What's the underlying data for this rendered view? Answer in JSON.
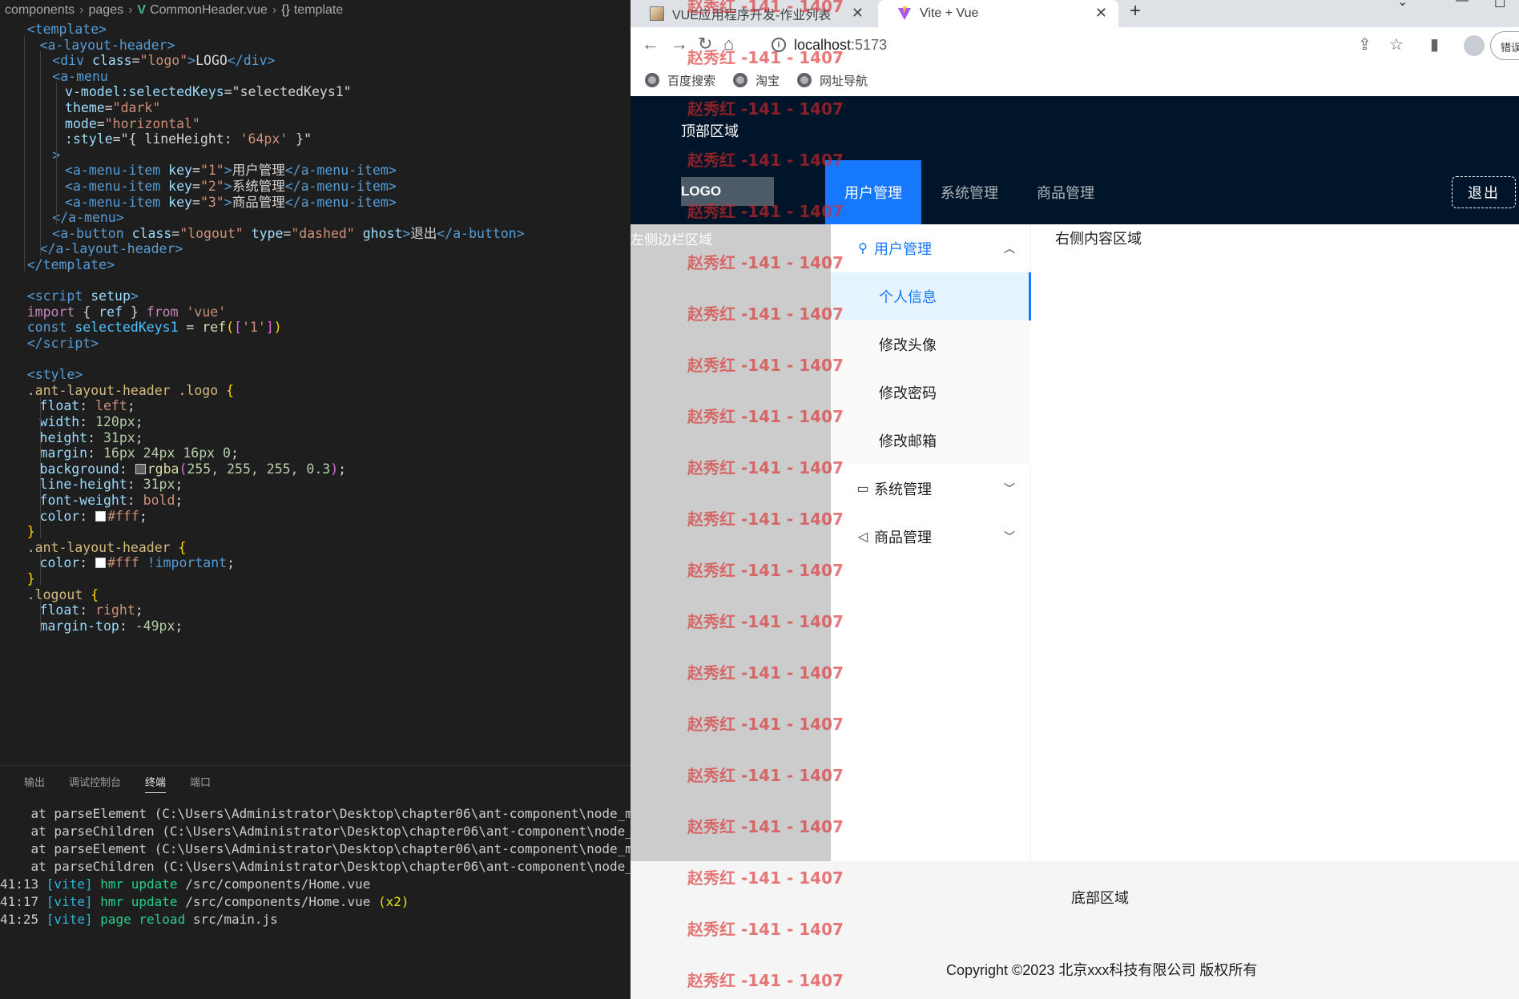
{
  "editor": {
    "breadcrumb": [
      "components",
      "pages",
      "CommonHeader.vue",
      "template"
    ],
    "code": [
      [
        [
          "<",
          "t-tag"
        ],
        [
          "template",
          "t-tag"
        ],
        [
          ">",
          "t-tag"
        ]
      ],
      [
        [
          "<",
          "t-tag"
        ],
        [
          "a-layout-header",
          "t-tag"
        ],
        [
          ">",
          "t-tag"
        ]
      ],
      [
        [
          "<",
          "t-tag"
        ],
        [
          "div",
          "t-tag"
        ],
        [
          " class",
          "t-attr"
        ],
        [
          "=",
          "t-txt"
        ],
        [
          "\"logo\"",
          "t-str"
        ],
        [
          ">",
          "t-tag"
        ],
        [
          "LOGO",
          "t-txt"
        ],
        [
          "</",
          "t-tag"
        ],
        [
          "div",
          "t-tag"
        ],
        [
          ">",
          "t-tag"
        ]
      ],
      [
        [
          "<",
          "t-tag"
        ],
        [
          "a-menu",
          "t-tag"
        ]
      ],
      [
        [
          "v-model:selectedKeys",
          "t-attr"
        ],
        [
          "=",
          "t-txt"
        ],
        [
          "\"selectedKeys1\"",
          "t-txt"
        ]
      ],
      [
        [
          "theme",
          "t-attr"
        ],
        [
          "=",
          "t-txt"
        ],
        [
          "\"dark\"",
          "t-str"
        ]
      ],
      [
        [
          "mode",
          "t-attr"
        ],
        [
          "=",
          "t-txt"
        ],
        [
          "\"horizontal\"",
          "t-str"
        ]
      ],
      [
        [
          ":style",
          "t-attr"
        ],
        [
          "=",
          "t-txt"
        ],
        [
          "\"{ lineHeight: ",
          "t-txt"
        ],
        [
          "'64px'",
          "t-str"
        ],
        [
          " }\"",
          "t-txt"
        ]
      ],
      [
        [
          ">",
          "t-tag"
        ]
      ],
      [
        [
          "<",
          "t-tag"
        ],
        [
          "a-menu-item",
          "t-tag"
        ],
        [
          " key",
          "t-attr"
        ],
        [
          "=",
          "t-txt"
        ],
        [
          "\"1\"",
          "t-str"
        ],
        [
          ">",
          "t-tag"
        ],
        [
          "用户管理",
          "t-txt"
        ],
        [
          "</",
          "t-tag"
        ],
        [
          "a-menu-item",
          "t-tag"
        ],
        [
          ">",
          "t-tag"
        ]
      ],
      [
        [
          "<",
          "t-tag"
        ],
        [
          "a-menu-item",
          "t-tag"
        ],
        [
          " key",
          "t-attr"
        ],
        [
          "=",
          "t-txt"
        ],
        [
          "\"2\"",
          "t-str"
        ],
        [
          ">",
          "t-tag"
        ],
        [
          "系统管理",
          "t-txt"
        ],
        [
          "</",
          "t-tag"
        ],
        [
          "a-menu-item",
          "t-tag"
        ],
        [
          ">",
          "t-tag"
        ]
      ],
      [
        [
          "<",
          "t-tag"
        ],
        [
          "a-menu-item",
          "t-tag"
        ],
        [
          " key",
          "t-attr"
        ],
        [
          "=",
          "t-txt"
        ],
        [
          "\"3\"",
          "t-str"
        ],
        [
          ">",
          "t-tag"
        ],
        [
          "商品管理",
          "t-txt"
        ],
        [
          "</",
          "t-tag"
        ],
        [
          "a-menu-item",
          "t-tag"
        ],
        [
          ">",
          "t-tag"
        ]
      ],
      [
        [
          "</",
          "t-tag"
        ],
        [
          "a-menu",
          "t-tag"
        ],
        [
          ">",
          "t-tag"
        ]
      ],
      [
        [
          "<",
          "t-tag"
        ],
        [
          "a-button",
          "t-tag"
        ],
        [
          " class",
          "t-attr"
        ],
        [
          "=",
          "t-txt"
        ],
        [
          "\"logout\"",
          "t-str"
        ],
        [
          " type",
          "t-attr"
        ],
        [
          "=",
          "t-txt"
        ],
        [
          "\"dashed\"",
          "t-str"
        ],
        [
          " ghost",
          "t-attr"
        ],
        [
          ">",
          "t-tag"
        ],
        [
          "退出",
          "t-txt"
        ],
        [
          "</",
          "t-tag"
        ],
        [
          "a-button",
          "t-tag"
        ],
        [
          ">",
          "t-tag"
        ]
      ],
      [
        [
          "</",
          "t-tag"
        ],
        [
          "a-layout-header",
          "t-tag"
        ],
        [
          ">",
          "t-tag"
        ]
      ],
      [
        [
          "</",
          "t-tag"
        ],
        [
          "template",
          "t-tag"
        ],
        [
          ">",
          "t-tag"
        ]
      ],
      [],
      [
        [
          "<",
          "t-tag"
        ],
        [
          "script",
          "t-tag"
        ],
        [
          " setup",
          "t-attr"
        ],
        [
          ">",
          "t-tag"
        ]
      ],
      [
        [
          "import",
          "t-kw"
        ],
        [
          " { ",
          "t-txt"
        ],
        [
          "ref",
          "t-attr"
        ],
        [
          " } ",
          "t-txt"
        ],
        [
          "from",
          "t-kw"
        ],
        [
          " ",
          "t-txt"
        ],
        [
          "'vue'",
          "t-str"
        ]
      ],
      [
        [
          "const",
          "t-kwb"
        ],
        [
          " ",
          "t-txt"
        ],
        [
          "selectedKeys1",
          "t-var"
        ],
        [
          " = ",
          "t-txt"
        ],
        [
          "ref",
          "t-fn"
        ],
        [
          "(",
          "t-br"
        ],
        [
          "[",
          "t-br2"
        ],
        [
          "'1'",
          "t-str"
        ],
        [
          "]",
          "t-br2"
        ],
        [
          ")",
          "t-br"
        ]
      ],
      [
        [
          "</",
          "t-tag"
        ],
        [
          "script",
          "t-tag"
        ],
        [
          ">",
          "t-tag"
        ]
      ],
      [],
      [
        [
          "<",
          "t-tag"
        ],
        [
          "style",
          "t-tag"
        ],
        [
          ">",
          "t-tag"
        ]
      ],
      [
        [
          ".ant-layout-header .logo",
          "t-sel"
        ],
        [
          " ",
          "t-txt"
        ],
        [
          "{",
          "t-br"
        ]
      ],
      [
        [
          "float",
          "t-prop"
        ],
        [
          ": ",
          "t-txt"
        ],
        [
          "left",
          "t-str"
        ],
        [
          ";",
          "t-txt"
        ]
      ],
      [
        [
          "width",
          "t-prop"
        ],
        [
          ": ",
          "t-txt"
        ],
        [
          "120px",
          "t-num"
        ],
        [
          ";",
          "t-txt"
        ]
      ],
      [
        [
          "height",
          "t-prop"
        ],
        [
          ": ",
          "t-txt"
        ],
        [
          "31px",
          "t-num"
        ],
        [
          ";",
          "t-txt"
        ]
      ],
      [
        [
          "margin",
          "t-prop"
        ],
        [
          ": ",
          "t-txt"
        ],
        [
          "16px 24px 16px 0",
          "t-num"
        ],
        [
          ";",
          "t-txt"
        ]
      ],
      [
        [
          "background",
          "t-prop"
        ],
        [
          ": ",
          "t-txt"
        ],
        [
          "SW:rgba(255,255,255,0.3)",
          "sw"
        ],
        [
          "rgba",
          "t-fn"
        ],
        [
          "(",
          "t-br2"
        ],
        [
          "255, 255, 255, 0.3",
          "t-num"
        ],
        [
          ")",
          "t-br2"
        ],
        [
          ";",
          "t-txt"
        ]
      ],
      [
        [
          "line-height",
          "t-prop"
        ],
        [
          ": ",
          "t-txt"
        ],
        [
          "31px",
          "t-num"
        ],
        [
          ";",
          "t-txt"
        ]
      ],
      [
        [
          "font-weight",
          "t-prop"
        ],
        [
          ": ",
          "t-txt"
        ],
        [
          "bold",
          "t-str"
        ],
        [
          ";",
          "t-txt"
        ]
      ],
      [
        [
          "color",
          "t-prop"
        ],
        [
          ": ",
          "t-txt"
        ],
        [
          "SW:#ffffff",
          "sw"
        ],
        [
          "#fff",
          "t-str"
        ],
        [
          ";",
          "t-txt"
        ]
      ],
      [
        [
          "}",
          "t-br"
        ]
      ],
      [
        [
          ".ant-layout-header",
          "t-sel"
        ],
        [
          " ",
          "t-txt"
        ],
        [
          "{",
          "t-br"
        ]
      ],
      [
        [
          "color",
          "t-prop"
        ],
        [
          ": ",
          "t-txt"
        ],
        [
          "SW:#ffffff",
          "sw"
        ],
        [
          "#fff",
          "t-str"
        ],
        [
          " !important",
          "t-kwb"
        ],
        [
          ";",
          "t-txt"
        ]
      ],
      [
        [
          "}",
          "t-br"
        ]
      ],
      [
        [
          ".logout",
          "t-sel"
        ],
        [
          " ",
          "t-txt"
        ],
        [
          "{",
          "t-br"
        ]
      ],
      [
        [
          "float",
          "t-prop"
        ],
        [
          ": ",
          "t-txt"
        ],
        [
          "right",
          "t-str"
        ],
        [
          ";",
          "t-txt"
        ]
      ],
      [
        [
          "margin-top",
          "t-prop"
        ],
        [
          ": ",
          "t-txt"
        ],
        [
          "-49px",
          "t-num"
        ],
        [
          ";",
          "t-txt"
        ]
      ]
    ],
    "panel_tabs": [
      "输出",
      "调试控制台",
      "终端",
      "端口"
    ],
    "active_panel_tab": "终端",
    "terminal": [
      [
        [
          "    at parseElement (C:\\Users\\Administrator\\Desktop\\chapter06\\ant-component\\node_modules\\",
          ""
        ]
      ],
      [
        [
          "    at parseChildren (C:\\Users\\Administrator\\Desktop\\chapter06\\ant-component\\node_modules",
          ""
        ]
      ],
      [
        [
          "    at parseElement (C:\\Users\\Administrator\\Desktop\\chapter06\\ant-component\\node_modules\\",
          ""
        ]
      ],
      [
        [
          "    at parseChildren (C:\\Users\\Administrator\\Desktop\\chapter06\\ant-component\\node_modules",
          ""
        ]
      ],
      [
        [
          "41:13 ",
          ""
        ],
        [
          "[vite]",
          "c-cyan"
        ],
        [
          " ",
          ""
        ],
        [
          "hmr update",
          "c-green"
        ],
        [
          " /src/components/Home.vue",
          ""
        ]
      ],
      [
        [
          "41:17 ",
          ""
        ],
        [
          "[vite]",
          "c-cyan"
        ],
        [
          " ",
          ""
        ],
        [
          "hmr update",
          "c-green"
        ],
        [
          " /src/components/Home.vue ",
          ""
        ],
        [
          "(x2)",
          "c-yellow"
        ]
      ],
      [
        [
          "41:25 ",
          ""
        ],
        [
          "[vite]",
          "c-cyan"
        ],
        [
          " ",
          ""
        ],
        [
          "page reload",
          "c-green"
        ],
        [
          " src/main.js",
          ""
        ]
      ]
    ]
  },
  "browser": {
    "tabs": [
      {
        "title": "VUE应用程序开发-作业列表",
        "icon": "document-favicon"
      },
      {
        "title": "Vite + Vue",
        "icon": "vite-favicon"
      }
    ],
    "new_tab": "+",
    "window_controls": [
      "⌄",
      "—",
      "☐"
    ],
    "address": {
      "host": "localhost",
      "port": ":5173"
    },
    "error_chip": "错误",
    "bookmarks": [
      "百度搜索",
      "淘宝",
      "网址导航"
    ]
  },
  "app": {
    "header_area_label": "顶部区域",
    "logo": "LOGO",
    "top_menu": [
      "用户管理",
      "系统管理",
      "商品管理"
    ],
    "top_menu_selected": 0,
    "logout": "退出",
    "sider_label": "左侧边栏区域",
    "side_menu": {
      "groups": [
        {
          "label": "用户管理",
          "icon": "user-icon",
          "open": true,
          "items": [
            "个人信息",
            "修改头像",
            "修改密码",
            "修改邮箱"
          ]
        },
        {
          "label": "系统管理",
          "icon": "laptop-icon",
          "open": false
        },
        {
          "label": "商品管理",
          "icon": "notification-icon",
          "open": false
        }
      ],
      "selected_item": "个人信息"
    },
    "content_label": "右侧内容区域",
    "footer_area_label": "底部区域",
    "copyright": "Copyright ©2023 北京xxx科技有限公司 版权所有",
    "watermark": "赵秀红 -141 - 1407"
  },
  "colors": {
    "header_bg": "#001529",
    "primary": "#1677ff",
    "sider_bg": "#cccccc",
    "footer_bg": "#f5f5f5",
    "editor_bg": "#1e1e1e",
    "watermark": "#dc2828"
  }
}
